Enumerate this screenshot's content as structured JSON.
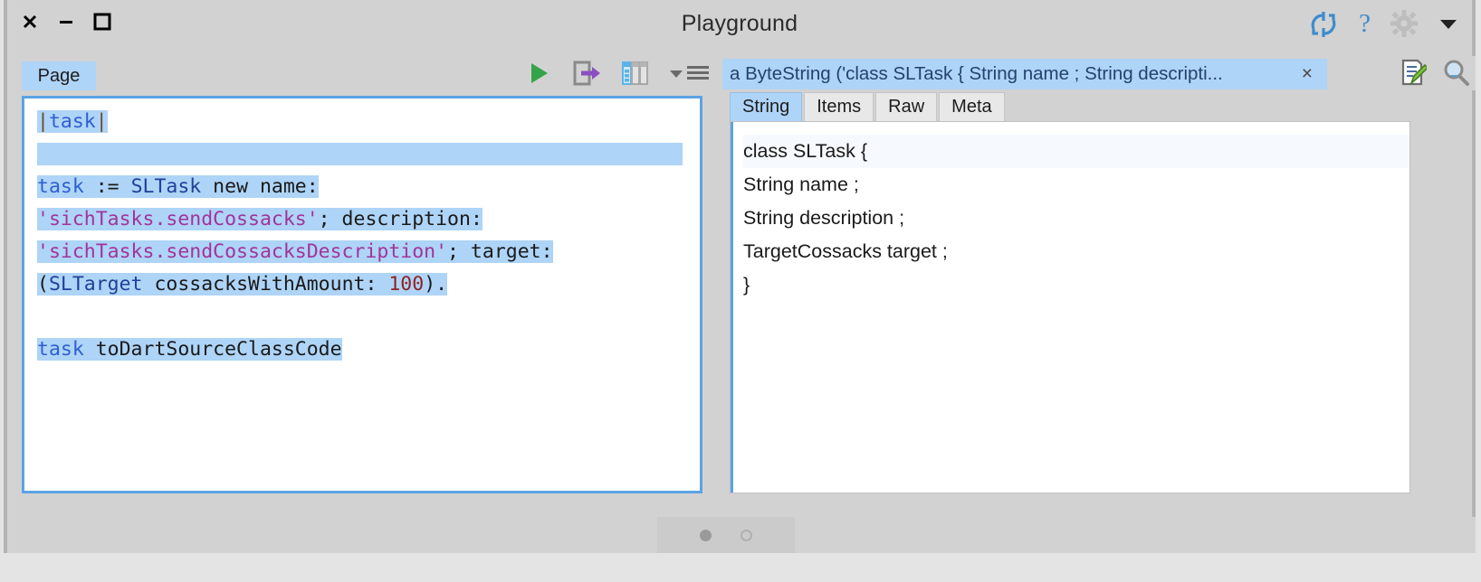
{
  "window": {
    "title": "Playground",
    "controls": [
      {
        "name": "close",
        "glyph": "close-icon"
      },
      {
        "name": "minimize",
        "glyph": "minimize-icon"
      },
      {
        "name": "maximize",
        "glyph": "maximize-icon"
      }
    ],
    "title_right_icons": [
      {
        "name": "sync-icon",
        "color": "#3d8bcd"
      },
      {
        "name": "help-icon",
        "label": "?",
        "color": "#3d8bcd"
      },
      {
        "name": "gear-icon",
        "color": "#b8b8b8"
      },
      {
        "name": "chevron-down-icon",
        "color": "#222222"
      }
    ]
  },
  "left_pane": {
    "tab_label": "Page",
    "toolbar": [
      {
        "name": "do-it-button",
        "icon": "play-icon",
        "color": "#33a447"
      },
      {
        "name": "do-it-and-go-button",
        "icon": "export-arrow-icon",
        "color": "#8b4fc0"
      },
      {
        "name": "inspect-it-button",
        "icon": "table-columns-icon",
        "color": "#5bb3e8"
      },
      {
        "name": "more-menu-button",
        "icon": "menu-chevron-icon",
        "color": "#6a6a6a"
      }
    ],
    "code_lines": [
      {
        "selected": true,
        "tokens": [
          {
            "t": "|",
            "c": "pipe"
          },
          {
            "t": "task",
            "c": "kw-var"
          },
          {
            "t": "|",
            "c": "pipe"
          }
        ]
      },
      {
        "selected": true,
        "tokens": []
      },
      {
        "selected": true,
        "tokens": [
          {
            "t": "task",
            "c": "kw-var"
          },
          {
            "t": " := ",
            "c": "plain"
          },
          {
            "t": "SLTask",
            "c": "kw-cls"
          },
          {
            "t": " new name:",
            "c": "plain"
          }
        ]
      },
      {
        "selected": true,
        "tokens": [
          {
            "t": "'sichTasks.sendCossacks'",
            "c": "str"
          },
          {
            "t": "; description:",
            "c": "plain"
          }
        ]
      },
      {
        "selected": true,
        "tokens": [
          {
            "t": "'sichTasks.sendCossacksDescription'",
            "c": "str"
          },
          {
            "t": "; target:",
            "c": "plain"
          }
        ]
      },
      {
        "selected": true,
        "tokens": [
          {
            "t": "(",
            "c": "plain"
          },
          {
            "t": "SLTarget",
            "c": "kw-cls"
          },
          {
            "t": " cossacksWithAmount: ",
            "c": "plain"
          },
          {
            "t": "100",
            "c": "num"
          },
          {
            "t": ").",
            "c": "plain"
          }
        ]
      },
      {
        "selected": false,
        "tokens": []
      },
      {
        "selected": true,
        "tokens": [
          {
            "t": "task",
            "c": "kw-var"
          },
          {
            "t": " toDartSourceClassCode",
            "c": "plain"
          }
        ]
      }
    ]
  },
  "right_pane": {
    "object_tab_label": "a ByteString ('class SLTask { String name ; String descripti...",
    "object_tab_close": "×",
    "tools": [
      {
        "name": "edit-document-icon"
      },
      {
        "name": "search-icon"
      }
    ],
    "subtabs": [
      {
        "label": "String",
        "active": true
      },
      {
        "label": "Items",
        "active": false
      },
      {
        "label": "Raw",
        "active": false
      },
      {
        "label": "Meta",
        "active": false
      }
    ],
    "viewer_lines": [
      "class SLTask {",
      "String name ;",
      "String description ;",
      "TargetCossacks target ;",
      "}"
    ]
  },
  "bottom_bar": {
    "dots": [
      {
        "name": "page-dot-1",
        "state": "filled"
      },
      {
        "name": "page-dot-2",
        "state": "hollow"
      }
    ]
  },
  "colors": {
    "selection": "#aed4f7",
    "focus_border": "#5ca3e4",
    "chrome": "#d2d2d2",
    "accent_blue": "#3d8bcd",
    "string_magenta": "#a3339b",
    "number_maroon": "#8f2222"
  }
}
